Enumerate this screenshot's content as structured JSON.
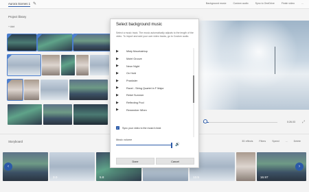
{
  "topbar": {
    "project_title": "Aurora Scenes 1",
    "edit_icon": "pencil-icon",
    "actions": [
      "Background music",
      "Custom audio",
      "Sync to OneDrive",
      "Finish video",
      "..."
    ]
  },
  "library": {
    "title": "Project library",
    "add_label": "+ Add",
    "icons": {
      "collapse": "chevron-left-icon"
    }
  },
  "preview": {
    "time": "0:26.03"
  },
  "storyboard": {
    "title": "Storyboard",
    "tools": [
      "3D effects",
      "Filters",
      "Speed",
      "...",
      "Delete"
    ],
    "cards": [
      {
        "duration": "",
        "vol": ""
      },
      {
        "duration": "3.0",
        "vol": ""
      },
      {
        "duration": "5.8",
        "vol": ""
      },
      {
        "duration": "",
        "vol": ""
      },
      {
        "duration": "13.5",
        "vol": ""
      },
      {
        "duration": "",
        "vol": ""
      },
      {
        "duration": "16.97",
        "vol": ""
      }
    ]
  },
  "dialog": {
    "title": "Select background music",
    "description": "Select a music track. The music automatically adjusts to the length of the video. To import and add your own video tracks, go to Custom audio.",
    "tracks": [
      "Misty Mountaintop",
      "Motel Groove",
      "Neon Night",
      "On Hold",
      "Prankster",
      "Ravel - String Quartet in F Major",
      "Rebel Summer",
      "Reflecting Pool",
      "Remember When"
    ],
    "sync_label": "Sync your video to the music's beat",
    "music_volume_label": "Music volume",
    "music_volume_level": 0.95,
    "done_label": "Done",
    "cancel_label": "Cancel"
  },
  "colors": {
    "accent": "#2b5aa8"
  }
}
